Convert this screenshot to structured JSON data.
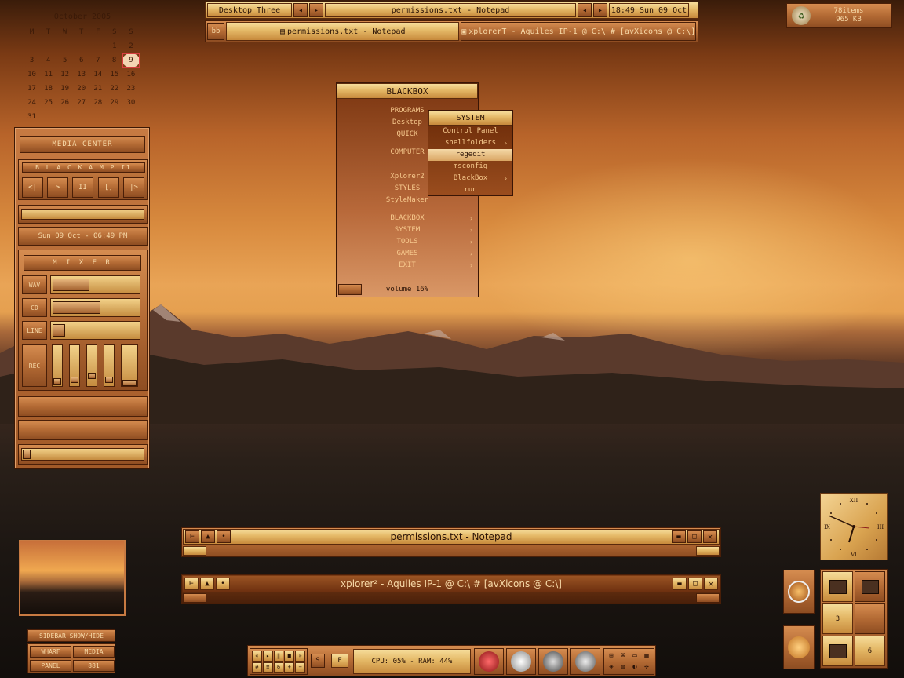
{
  "calendar": {
    "title": "October 2005",
    "weekdays": [
      "M",
      "T",
      "W",
      "T",
      "F",
      "S",
      "S"
    ],
    "weeks": [
      [
        "",
        "",
        "",
        "",
        "",
        "1",
        "2"
      ],
      [
        "3",
        "4",
        "5",
        "6",
        "7",
        "8",
        "9"
      ],
      [
        "10",
        "11",
        "12",
        "13",
        "14",
        "15",
        "16"
      ],
      [
        "17",
        "18",
        "19",
        "20",
        "21",
        "22",
        "23"
      ],
      [
        "24",
        "25",
        "26",
        "27",
        "28",
        "29",
        "30"
      ],
      [
        "31",
        "",
        "",
        "",
        "",
        "",
        ""
      ]
    ],
    "today": "9"
  },
  "toolbar": {
    "workspace": "Desktop Three",
    "window_title": "permissions.txt - Notepad",
    "clock": "18:49 Sun 09 Oct",
    "prev_icon": "arrow-left-icon",
    "next_icon": "arrow-right-icon"
  },
  "tasks": {
    "bb_label": "bb",
    "items": [
      "permissions.txt - Notepad",
      "xplorerT - Aquiles IP-1 @ C:\\ # [avXicons @ C:\\]"
    ]
  },
  "recycle": {
    "items": "78items",
    "size": "965 KB",
    "icon": "recycle-bin-icon"
  },
  "mediacenter": {
    "title": "MEDIA CENTER",
    "player": "B L A C K A M P  II",
    "controls": [
      "<|",
      ">",
      "II",
      "[]",
      "|>"
    ],
    "datetime": "Sun 09 Oct - 06:49 PM",
    "mixer_title": "M I X E R",
    "channels": [
      {
        "label": "WAV",
        "level": 0.42
      },
      {
        "label": "CD",
        "level": 0.55
      },
      {
        "label": "LINE",
        "level": 0.12
      }
    ],
    "rec_label": "REC",
    "rec_levels": [
      0.05,
      0.1,
      0.2,
      0.08,
      0.0
    ]
  },
  "menu": {
    "title": "BLACKBOX",
    "items": [
      {
        "label": "PROGRAMS",
        "arrow": ""
      },
      {
        "label": "Desktop",
        "arrow": ""
      },
      {
        "label": "QUICK",
        "arrow": ""
      },
      {
        "label": "COMPUTER",
        "arrow": ""
      },
      {
        "label": "Xplorer2",
        "arrow": ""
      },
      {
        "label": "STYLES",
        "arrow": ""
      },
      {
        "label": "StyleMaker",
        "arrow": ""
      },
      {
        "label": "BLACKBOX",
        "arrow": "›"
      },
      {
        "label": "SYSTEM",
        "arrow": "›"
      },
      {
        "label": "TOOLS",
        "arrow": "›"
      },
      {
        "label": "GAMES",
        "arrow": "›"
      },
      {
        "label": "EXIT",
        "arrow": "›"
      }
    ],
    "volume": "volume 16%",
    "volume_level": 0.16
  },
  "submenu": {
    "title": "SYSTEM",
    "items": [
      {
        "label": "Control Panel",
        "arrow": ""
      },
      {
        "label": "shellfolders",
        "arrow": "›"
      },
      {
        "label": "regedit",
        "arrow": ""
      },
      {
        "label": "msconfig",
        "arrow": ""
      },
      {
        "label": "BlackBox",
        "arrow": "›"
      },
      {
        "label": "run",
        "arrow": ""
      }
    ],
    "selected": "regedit"
  },
  "windows": [
    {
      "title": "permissions.txt - Notepad"
    },
    {
      "title": "xplorer² - Aquiles IP-1 @ C:\\ # [avXicons @ C:\\]"
    }
  ],
  "sidebar": {
    "title": "SIDEBAR SHOW/HIDE",
    "buttons": [
      "WHARF",
      "MEDIA",
      "PANEL",
      "881"
    ]
  },
  "bottombar": {
    "stats": "CPU: 05% - RAM: 44%",
    "s_label": "S",
    "f_label": "F"
  },
  "clock": {
    "numerals": [
      "XII",
      "III",
      "VI",
      "IX"
    ]
  },
  "pager": {
    "cells": [
      "",
      "",
      "3",
      "",
      "",
      "6"
    ]
  }
}
